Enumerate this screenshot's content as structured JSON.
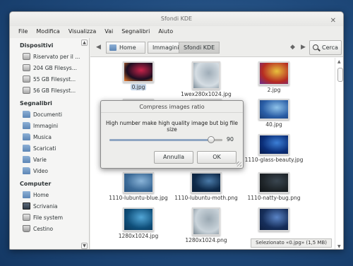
{
  "window": {
    "title": "Sfondi KDE"
  },
  "menubar": [
    "File",
    "Modifica",
    "Visualizza",
    "Vai",
    "Segnalibri",
    "Aiuto"
  ],
  "sidebar": {
    "devices_heading": "Dispositivi",
    "devices": [
      "Riservato per il ...",
      "204 GB Filesys...",
      "55 GB Filesyst...",
      "56 GB Filesyst..."
    ],
    "bookmarks_heading": "Segnalibri",
    "bookmarks": [
      "Documenti",
      "Immagini",
      "Musica",
      "Scaricati",
      "Varie",
      "Video"
    ],
    "computer_heading": "Computer",
    "computer": [
      "Home",
      "Scrivania",
      "File system",
      "Cestino"
    ]
  },
  "toolbar": {
    "breadcrumbs": [
      "Home",
      "Immagini",
      "Sfondi KDE"
    ],
    "search_label": "Cerca"
  },
  "files": [
    {
      "name": "0.jpg",
      "selected": true,
      "colors": [
        "#1a0d20",
        "#c9234a",
        "#f07d2a"
      ]
    },
    {
      "name": "1wex280x1024.jpg",
      "colors": [
        "#d5dde3",
        "#9fadb8",
        "#7e8e9a"
      ]
    },
    {
      "name": "2.jpg",
      "colors": [
        "#b62b22",
        "#e8c13c",
        "#6a2c8e"
      ]
    },
    {
      "name": "",
      "colors": [
        "#2a3a52",
        "#3c5478",
        "#1e2c40"
      ]
    },
    {
      "name": "",
      "colors": [
        "#1e2c40",
        "#2a3a52",
        "#1a2232"
      ]
    },
    {
      "name": "40.jpg",
      "colors": [
        "#2a5ea6",
        "#8fc3ea",
        "#1b3f78"
      ]
    },
    {
      "name": "",
      "colors": [
        "#1a2a4a",
        "#2e4a7a",
        "#162238"
      ]
    },
    {
      "name": "",
      "colors": [
        "#1a2a4a",
        "#2e4a7a",
        "#162238"
      ]
    },
    {
      "name": "1110-glass-beauty.jpg",
      "colors": [
        "#0b2f7a",
        "#3c7fd6",
        "#071a4a"
      ]
    },
    {
      "name": "1110-lubuntu-blue.jpg",
      "colors": [
        "#3d6c99",
        "#8ab4d8",
        "#2a5580"
      ]
    },
    {
      "name": "1110-lubuntu-moth.png",
      "colors": [
        "#0e2a4a",
        "#4a7aa8",
        "#0a1e36"
      ]
    },
    {
      "name": "1110-natty-bug.png",
      "colors": [
        "#1e2428",
        "#3a4650",
        "#101418"
      ]
    },
    {
      "name": "1280x1024.jpg",
      "colors": [
        "#0f4f7a",
        "#52a6d6",
        "#0b3556"
      ]
    },
    {
      "name": "1280x1024.png",
      "colors": [
        "#c9d3da",
        "#9aa8b2",
        "#7d8b95"
      ]
    },
    {
      "name": "",
      "colors": [
        "#162e5a",
        "#5a84c6",
        "#0e1f40"
      ]
    }
  ],
  "dialog": {
    "title": "Compress images ratio",
    "message": "High number make high quality image but big file size",
    "value": 90,
    "value_label": "90",
    "cancel_label": "Annulla",
    "ok_label": "OK"
  },
  "status": "Selezionato «0.jpg» (1,5 MB)"
}
